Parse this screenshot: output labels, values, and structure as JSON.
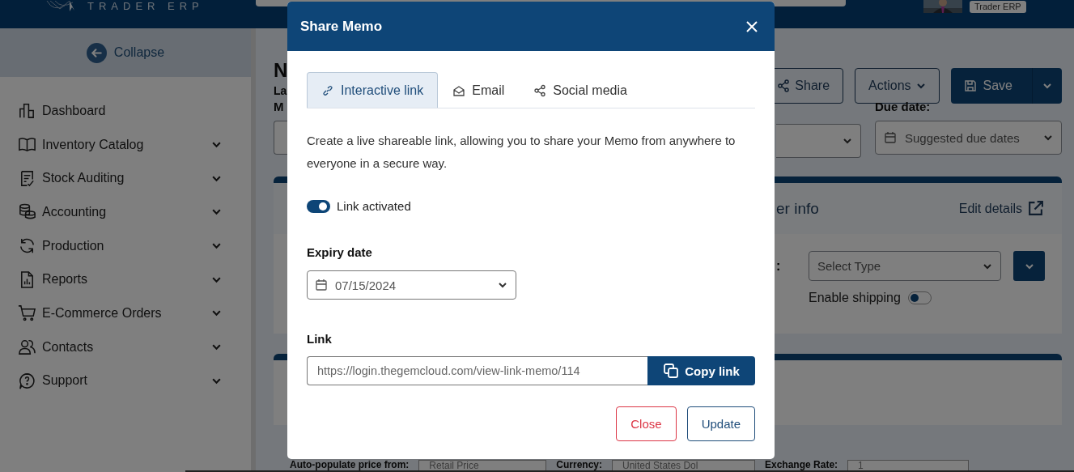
{
  "topbar": {
    "logo_text": "TRADER ERP",
    "badge": "Trader ERP"
  },
  "sidebar": {
    "collapse": "Collapse",
    "items": [
      {
        "label": "Dashboard",
        "kind": "link"
      },
      {
        "label": "Inventory Catalog",
        "kind": "menu"
      },
      {
        "label": "Stock Auditing",
        "kind": "menu"
      },
      {
        "label": "Accounting",
        "kind": "menu"
      },
      {
        "label": "Production",
        "kind": "menu"
      },
      {
        "label": "Reports",
        "kind": "menu"
      },
      {
        "label": "E-Commerce Orders",
        "kind": "menu"
      },
      {
        "label": "Contacts",
        "kind": "menu"
      },
      {
        "label": "Support",
        "kind": "menu"
      }
    ]
  },
  "page": {
    "title": "N",
    "subtitle": "La",
    "field_label": "M",
    "share": "Share",
    "actions": "Actions",
    "save": "Save",
    "due_date": {
      "label": "Due date:",
      "placeholder": "Suggested due dates"
    },
    "info_card": {
      "title": "er info",
      "edit": "Edit details",
      "type_label": ":",
      "type_placeholder": "Select Type",
      "shipping": {
        "label": "Enable shipping",
        "on": false
      }
    },
    "bottom_row": {
      "price_label": "Auto-populate price from:",
      "price_value": "Retail Price",
      "currency_label": "Currency:",
      "currency_value": "United States Dol",
      "rate_label": "Exchange Rate:",
      "rate_value": "1"
    }
  },
  "modal": {
    "title": "Share Memo",
    "tabs": [
      {
        "label": "Interactive link",
        "selected": true
      },
      {
        "label": "Email",
        "selected": false
      },
      {
        "label": "Social media",
        "selected": false
      }
    ],
    "description": "Create a live shareable link, allowing you to share your Memo from anywhere to everyone in a secure way.",
    "link_activated": {
      "label": "Link activated",
      "on": true
    },
    "expiry": {
      "label": "Expiry date",
      "value": "07/15/2024"
    },
    "link": {
      "label": "Link",
      "value": "https://login.thegemcloud.com/view-link-memo/114",
      "button": "Copy link"
    },
    "buttons": [
      {
        "label": "Close",
        "kind": "danger"
      },
      {
        "label": "Update",
        "kind": "primary"
      }
    ]
  }
}
